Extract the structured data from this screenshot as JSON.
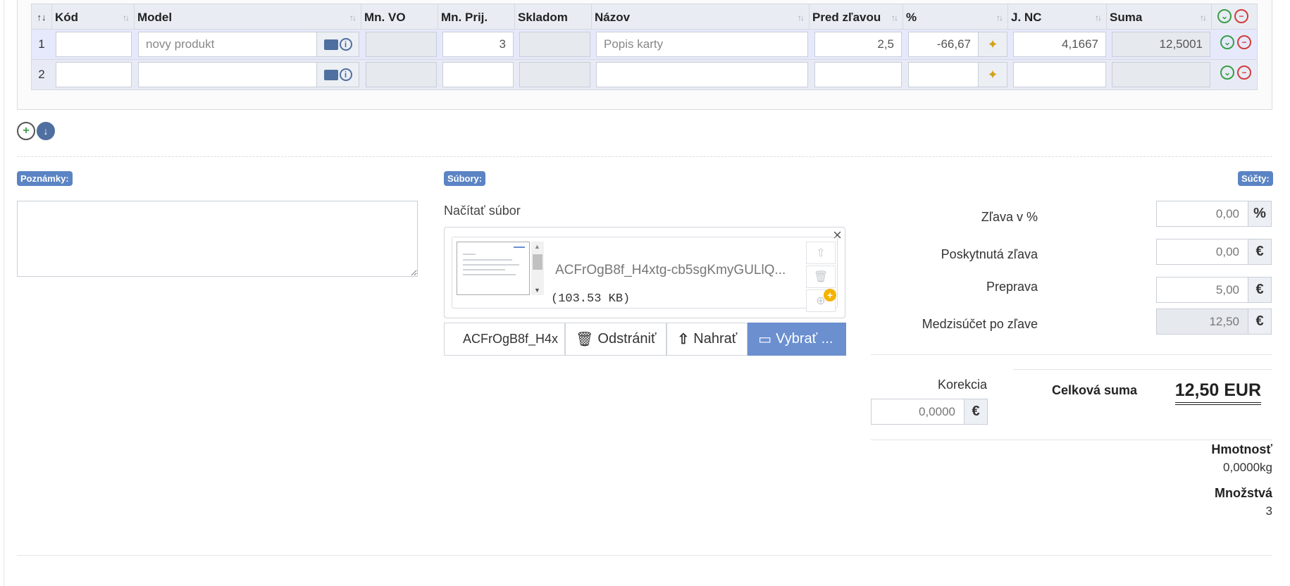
{
  "table": {
    "columns": [
      {
        "label": "Kód",
        "sortable": true
      },
      {
        "label": "Model",
        "sortable": true
      },
      {
        "label": "Mn. VO",
        "sortable": false
      },
      {
        "label": "Mn. Prij.",
        "sortable": false
      },
      {
        "label": "Skladom",
        "sortable": false
      },
      {
        "label": "Názov",
        "sortable": true
      },
      {
        "label": "Pred zľavou",
        "sortable": true
      },
      {
        "label": "%",
        "sortable": true
      },
      {
        "label": "J. NC",
        "sortable": true
      },
      {
        "label": "Suma",
        "sortable": true
      }
    ],
    "rows": [
      {
        "num": "1",
        "kod": "",
        "model_placeholder": "novy produkt",
        "mn_vo": "",
        "mn_prij": "3",
        "skladom": "",
        "nazov_placeholder": "Popis karty",
        "pred_zlavou": "2,5",
        "percent": "-66,67",
        "j_nc": "4,1667",
        "suma": "12,5001"
      },
      {
        "num": "2",
        "kod": "",
        "model_placeholder": "",
        "mn_vo": "",
        "mn_prij": "",
        "skladom": "",
        "nazov_placeholder": "",
        "pred_zlavou": "",
        "percent": "",
        "j_nc": "",
        "suma": ""
      }
    ]
  },
  "sections": {
    "notes_tag": "Poznámky:",
    "files_tag": "Súbory:",
    "sums_tag": "Súčty:"
  },
  "files": {
    "load_label": "Načítať súbor",
    "file_name": "ACFrOgB8f_H4xtg-cb5sgKmyGULlQ...",
    "file_size": "(103.53 KB)",
    "caption_value": "ACFrOgB8f_H4x",
    "remove_label": "Odstrániť",
    "upload_label": "Nahrať",
    "browse_label": "Vybrať ..."
  },
  "sums": {
    "discount_pct_label": "Zľava v %",
    "discount_pct_value": "0,00",
    "discount_pct_unit": "%",
    "discount_given_label": "Poskytnutá zľava",
    "discount_given_value": "0,00",
    "currency": "€",
    "shipping_label": "Preprava",
    "shipping_value": "5,00",
    "subtotal_label": "Medzisúčet po zľave",
    "subtotal_value": "12,50",
    "correction_label": "Korekcia",
    "correction_value": "0,0000",
    "total_label": "Celková suma",
    "total_value": "12,50 EUR",
    "weight_label": "Hmotnosť",
    "weight_value": "0,0000kg",
    "qty_label": "Množstvá",
    "qty_value": "3"
  }
}
